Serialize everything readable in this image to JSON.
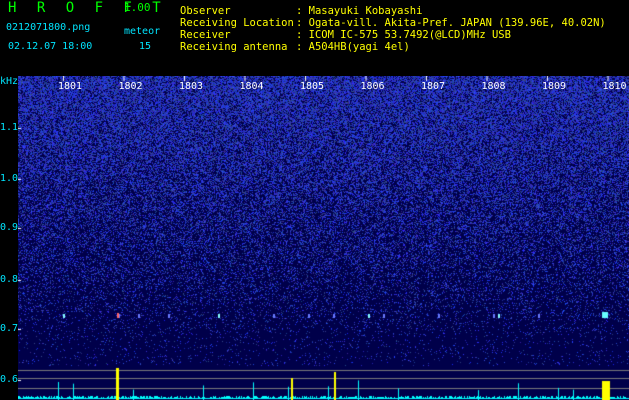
{
  "header": {
    "app_title": "H R O F F T",
    "app_version": "1.00",
    "filename": "0212071800.png",
    "meteor_label": "meteor",
    "datetime": "02.12.07 18:00",
    "meteor_count": "15"
  },
  "info": [
    {
      "label": "Observer",
      "value": ": Masayuki Kobayashi"
    },
    {
      "label": "Receiving Location",
      "value": ": Ogata-vill. Akita-Pref. JAPAN (139.96E, 40.02N)"
    },
    {
      "label": "Receiver",
      "value": ": ICOM IC-575 53.7492(@LCD)MHz USB"
    },
    {
      "label": "Receiving antenna",
      "value": ": A504HB(yagi 4el)"
    }
  ],
  "spectrogram": {
    "y_unit": "kHz",
    "y_ticks": [
      "1.1",
      "1.0",
      "0.9",
      "0.8",
      "0.7",
      "0.6"
    ],
    "x_ticks": [
      "1801",
      "1802",
      "1803",
      "1804",
      "1805",
      "1806",
      "1807",
      "1808",
      "1809",
      "1810"
    ],
    "colors": {
      "background": "#00004a",
      "noise": "#2a35c8",
      "axis_text": "#00e5ff",
      "meteor": "#ffff00",
      "trace": "#00ffff"
    }
  }
}
